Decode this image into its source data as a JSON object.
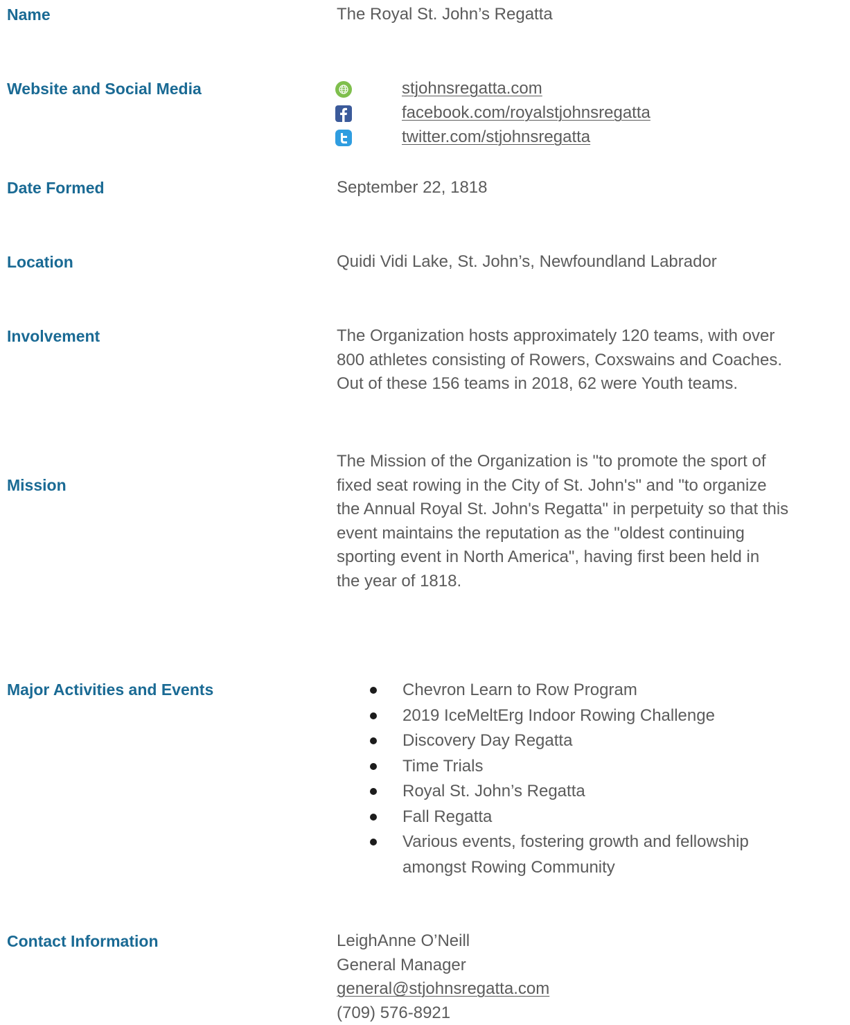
{
  "name": {
    "label": "Name",
    "value": "The Royal St. John’s Regatta"
  },
  "web": {
    "label": "Website and Social Media",
    "links": [
      {
        "icon": "globe-icon",
        "text": "stjohnsregatta.com"
      },
      {
        "icon": "facebook-icon",
        "text": "facebook.com/royalstjohnsregatta"
      },
      {
        "icon": "twitter-icon",
        "text": "twitter.com/stjohnsregatta"
      }
    ]
  },
  "formed": {
    "label": "Date Formed",
    "value": "September 22, 1818"
  },
  "location": {
    "label": "Location",
    "value": "Quidi Vidi Lake, St. John’s, Newfoundland Labrador"
  },
  "involvement": {
    "label": "Involvement",
    "lines": [
      "The Organization hosts approximately 120 teams, with over",
      "800 athletes consisting of Rowers, Coxswains and Coaches.",
      "Out of these 156 teams in 2018, 62 were Youth teams."
    ]
  },
  "mission": {
    "label": "Mission",
    "lines": [
      "The Mission of the Organization is \"to promote the sport of",
      "fixed seat rowing in the City of St. John's\" and \"to organize",
      "the Annual Royal St. John's Regatta\" in perpetuity so that this",
      "event maintains the reputation as the \"oldest continuing",
      "sporting event in North America\", having first been held in",
      "the year of 1818."
    ]
  },
  "activities": {
    "label": "Major Activities and Events",
    "items": [
      "Chevron Learn to Row Program",
      "2019 IceMeltErg Indoor Rowing Challenge",
      "Discovery Day Regatta",
      "Time Trials",
      "Royal St. John’s Regatta",
      "Fall Regatta",
      "Various events, fostering growth and fellowship",
      "amongst Rowing Community"
    ]
  },
  "contact": {
    "label": "Contact Information",
    "name": "LeighAnne O’Neill",
    "title": "General Manager",
    "email": "general@stjohnsregatta.com",
    "phone": "(709) 576-8921"
  },
  "colors": {
    "heading": "#1a6a94",
    "body": "#5b5b5b",
    "globe": "#7fbf4d",
    "facebook": "#3b5a9a",
    "twitter": "#2f9de0"
  }
}
